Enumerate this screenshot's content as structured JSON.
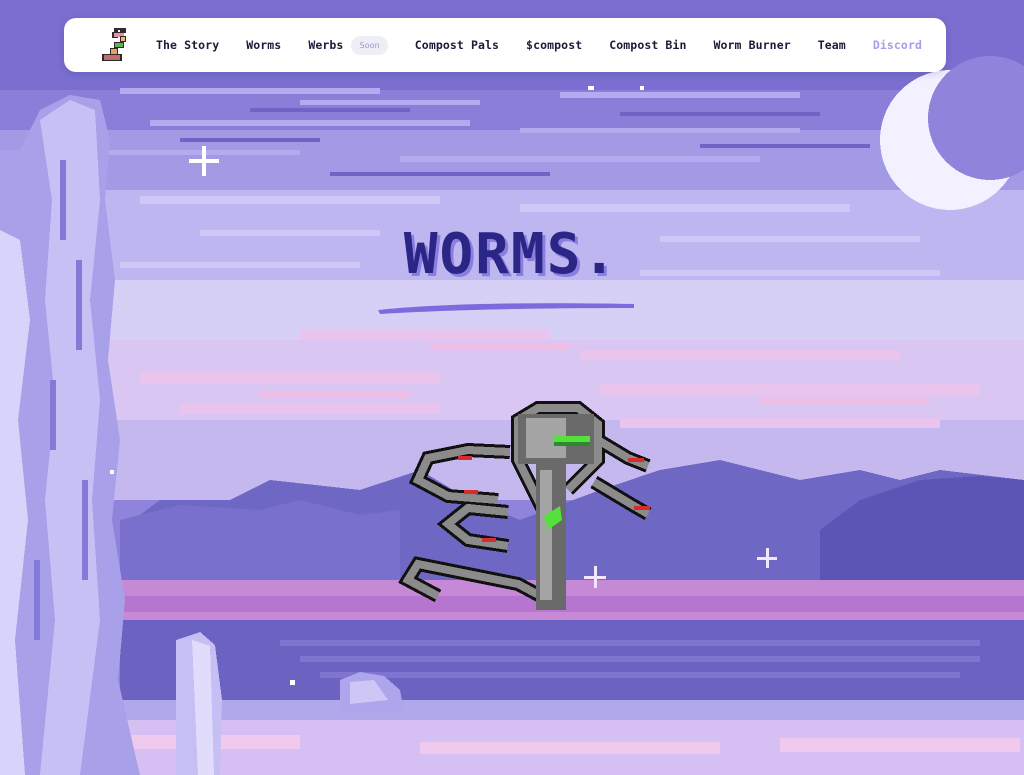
{
  "navbar": {
    "items": [
      {
        "label": "The Story"
      },
      {
        "label": "Worms"
      },
      {
        "label": "Werbs",
        "badge": "Soon"
      },
      {
        "label": "Compost Pals"
      },
      {
        "label": "$compost"
      },
      {
        "label": "Compost Bin"
      },
      {
        "label": "Worm Burner"
      },
      {
        "label": "Team"
      },
      {
        "label": "Discord"
      }
    ]
  },
  "hero": {
    "title": "WORMS."
  },
  "icons": {
    "logo": "worm-logo-icon",
    "moon": "crescent-moon-icon",
    "star": "sparkle-star-icon"
  },
  "colors": {
    "sky": "#9b8fe0",
    "title": "#2b2585",
    "accent": "#7b6bdc",
    "discord": "#a79ee8",
    "pink": "#e7a5e0"
  }
}
